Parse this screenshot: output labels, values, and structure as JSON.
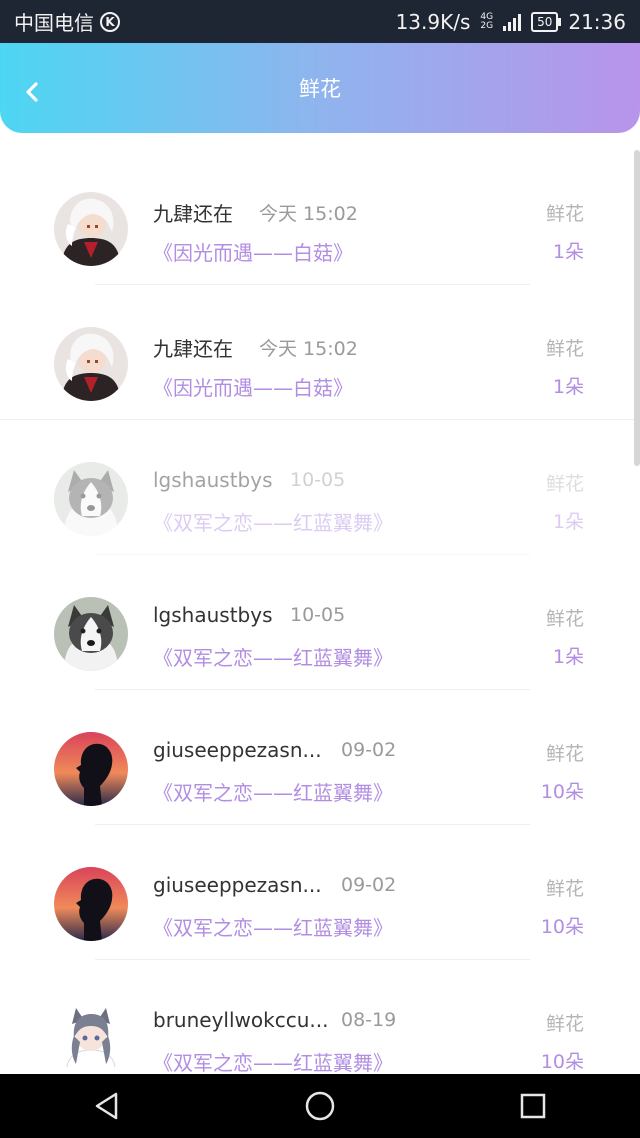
{
  "status_bar": {
    "carrier": "中国电信",
    "carrier_badge": "K",
    "speed": "13.9K/s",
    "network_top": "4G",
    "network_bottom": "2G",
    "battery": "50",
    "time": "21:36"
  },
  "header": {
    "title": "鲜花"
  },
  "items": [
    {
      "name": "九肆还在",
      "time": "今天 15:02",
      "song": "《因光而遇——白菇》",
      "category": "鲜花",
      "count": "1朵",
      "avatar": "anime-white-hair-avatar",
      "faded": false
    },
    {
      "name": "九肆还在",
      "time": "今天 15:02",
      "song": "《因光而遇——白菇》",
      "category": "鲜花",
      "count": "1朵",
      "avatar": "anime-white-hair-avatar",
      "faded": false
    },
    {
      "name": "lgshaustbys",
      "time": "10-05",
      "song": "《双军之恋——红蓝翼舞》",
      "category": "鲜花",
      "count": "1朵",
      "avatar": "husky-dog-avatar",
      "faded": true
    },
    {
      "name": "lgshaustbys",
      "time": "10-05",
      "song": "《双军之恋——红蓝翼舞》",
      "category": "鲜花",
      "count": "1朵",
      "avatar": "husky-dog-avatar",
      "faded": false
    },
    {
      "name": "giuseeppezasn...",
      "time": "09-02",
      "song": "《双军之恋——红蓝翼舞》",
      "category": "鲜花",
      "count": "10朵",
      "avatar": "sunset-silhouette-avatar",
      "faded": false
    },
    {
      "name": "giuseeppezasn...",
      "time": "09-02",
      "song": "《双军之恋——红蓝翼舞》",
      "category": "鲜花",
      "count": "10朵",
      "avatar": "sunset-silhouette-avatar",
      "faded": false
    },
    {
      "name": "bruneyllwokccu...",
      "time": "08-19",
      "song": "《双军之恋——红蓝翼舞》",
      "category": "鲜花",
      "count": "10朵",
      "avatar": "anime-girl-avatar",
      "faded": false
    }
  ]
}
